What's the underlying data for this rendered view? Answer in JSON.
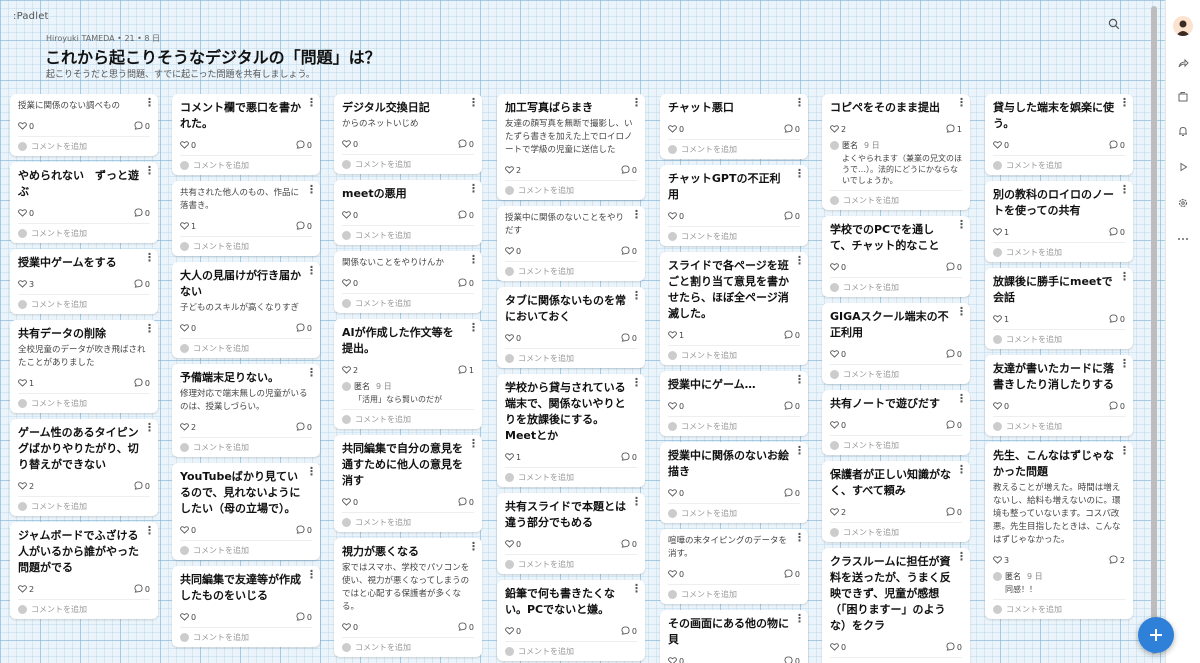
{
  "header": {
    "brand": ":Padlet",
    "author": "Hiroyuki TAMEDA • 21 • 8 日",
    "title": "これから起こりそうなデジタルの「問題」は？",
    "subtitle": "起こりそうだと思う問題、すでに起こった問題を共有しましょう。"
  },
  "add_comment": "コメントを追加",
  "columns": [
    [
      {
        "title": "授業に関係のない調べもの",
        "light": true,
        "likes": "0",
        "comments": "0"
      },
      {
        "title": "やめられない　ずっと遊ぶ",
        "likes": "0",
        "comments": "0"
      },
      {
        "title": "授業中ゲームをする",
        "likes": "3",
        "comments": "0"
      },
      {
        "title": "共有データの削除",
        "body": "全校児童のデータが吹き飛ばされたことがありました",
        "likes": "1",
        "comments": "0"
      },
      {
        "title": "ゲーム性のあるタイピングばかりやりたがり、切り替えができない",
        "likes": "2",
        "comments": "0"
      },
      {
        "title": "ジャムボードでふざける人がいるから誰がやった問題がでる",
        "likes": "2",
        "comments": "0"
      }
    ],
    [
      {
        "title": "コメント欄で悪口を書かれた。",
        "likes": "0",
        "comments": "0"
      },
      {
        "title": "共有された他人のもの、作品に落書き。",
        "light": true,
        "likes": "1",
        "comments": "0"
      },
      {
        "title": "大人の見届けが行き届かない",
        "body": "子どものスキルが高くなりすぎ",
        "likes": "0",
        "comments": "0"
      },
      {
        "title": "予備端末足りない。",
        "body": "修理対応で端末無しの児童がいるのは、授業しづらい。",
        "likes": "2",
        "comments": "0"
      },
      {
        "title": "YouTubeばかり見ているので、見れないようにしたい（母の立場で）。",
        "likes": "0",
        "comments": "0"
      },
      {
        "title": "共同編集で友達等が作成したものをいじる",
        "likes": "0",
        "comments": "0"
      }
    ],
    [
      {
        "title": "デジタル交換日記",
        "body": "からのネットいじめ",
        "likes": "0",
        "comments": "0"
      },
      {
        "title": "meetの悪用",
        "likes": "0",
        "comments": "0"
      },
      {
        "title": "関係ないことをやりけんか",
        "light": true,
        "likes": "0",
        "comments": "0"
      },
      {
        "title": "AIが作成した作文等を提出。",
        "likes": "2",
        "comments": "1",
        "comment": {
          "author": "匿名",
          "time": "9 日",
          "text": "「活用」なら賢いのだが"
        }
      },
      {
        "title": "共同編集で自分の意見を通すために他人の意見を消す",
        "likes": "0",
        "comments": "0"
      },
      {
        "title": "視力が悪くなる",
        "body": "家ではスマホ、学校でパソコンを使い、視力が悪くなってしまうのではと心配する保護者が多くなる。",
        "likes": "0",
        "comments": "0"
      }
    ],
    [
      {
        "title": "加工写真ばらまき",
        "body": "友達の顔写真を無断で撮影し、いたずら書きを加えた上でロイロノートで学級の児童に送信した",
        "likes": "2",
        "comments": "0"
      },
      {
        "title": "授業中に関係のないことをやりだす",
        "light": true,
        "likes": "0",
        "comments": "0"
      },
      {
        "title": "タブに関係ないものを常においておく",
        "likes": "0",
        "comments": "0"
      },
      {
        "title": "学校から貸与されている端末で、関係ないやりとりを放課後にする。Meetとか",
        "likes": "1",
        "comments": "0"
      },
      {
        "title": "共有スライドで本題とは違う部分でもめる",
        "likes": "0",
        "comments": "0"
      },
      {
        "title": "鉛筆で何も書きたくない。PCでないと嫌。",
        "likes": "0",
        "comments": "0"
      }
    ],
    [
      {
        "title": "チャット悪口",
        "likes": "0",
        "comments": "0"
      },
      {
        "title": "チャットGPTの不正利用",
        "likes": "0",
        "comments": "0"
      },
      {
        "title": "スライドで各ページを班ごと割り当て意見を書かせたら、ほぼ全ページ消滅した。",
        "likes": "1",
        "comments": "0"
      },
      {
        "title": "授業中にゲーム…",
        "likes": "0",
        "comments": "0"
      },
      {
        "title": "授業中に関係のないお絵描き",
        "likes": "0",
        "comments": "0"
      },
      {
        "title": "喧嘩の末タイピングのデータを消す。",
        "light": true,
        "likes": "0",
        "comments": "0"
      },
      {
        "title": "その画面にある他の物に貝",
        "likes": "0",
        "comments": "0"
      }
    ],
    [
      {
        "title": "コピペをそのまま提出",
        "likes": "2",
        "comments": "1",
        "comment": {
          "author": "匿名",
          "time": "9 日",
          "text": "よくやられます（兼業の兄文のほうで…）。法的にどうにかならないでしょうか。"
        }
      },
      {
        "title": "学校でのPCでを通して、チャット的なこと",
        "likes": "0",
        "comments": "0"
      },
      {
        "title": "GIGAスクール端末の不正利用",
        "likes": "0",
        "comments": "0"
      },
      {
        "title": "共有ノートで遊びだす",
        "likes": "0",
        "comments": "0"
      },
      {
        "title": "保護者が正しい知識がなく、すべて頼み",
        "likes": "2",
        "comments": "0"
      },
      {
        "title": "クラスルームに担任が資料を送ったが、うまく反映できず、児童が感想（「困りますー」のような）をクラ",
        "likes": "0",
        "comments": "0"
      }
    ],
    [
      {
        "title": "貸与した端末を娯楽に使う。",
        "likes": "0",
        "comments": "0"
      },
      {
        "title": "別の教科のロイロのノートを使っての共有",
        "likes": "1",
        "comments": "0"
      },
      {
        "title": "放課後に勝手にmeetで会話",
        "likes": "1",
        "comments": "0"
      },
      {
        "title": "友達が書いたカードに落書きしたり消したりする",
        "likes": "0",
        "comments": "0"
      },
      {
        "title": "先生、こんなはずじゃなかった問題",
        "body": "教えることが増えた。時間は増えないし、給料も増えないのに。環境も整っていないます。コスパ改悪。先生目指したときは、こんなはずじゃなかった。",
        "likes": "3",
        "comments": "2",
        "comment": {
          "author": "匿名",
          "time": "9 日",
          "text": "同感！！"
        }
      }
    ]
  ]
}
